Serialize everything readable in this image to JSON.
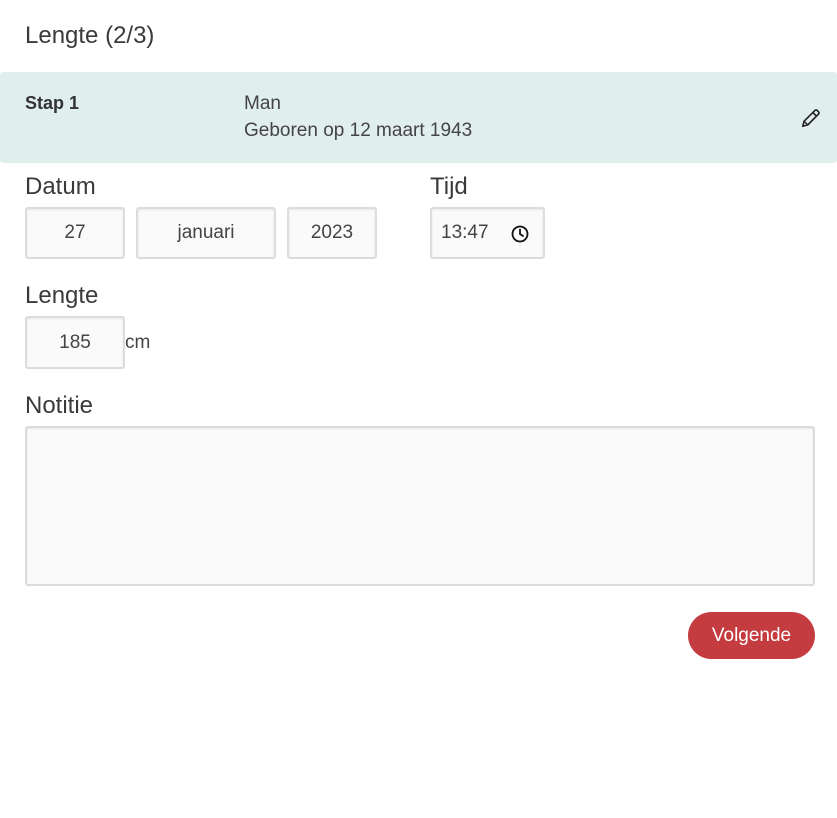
{
  "page": {
    "title": "Lengte (2/3)"
  },
  "step": {
    "label": "Stap 1",
    "gender": "Man",
    "birth": "Geboren op 12 maart 1943",
    "edit_icon": "pencil-icon"
  },
  "datum": {
    "label": "Datum",
    "day": "27",
    "month": "januari",
    "year": "2023"
  },
  "tijd": {
    "label": "Tijd",
    "value": "13:47",
    "icon": "clock-icon"
  },
  "lengte": {
    "label": "Lengte",
    "value": "185",
    "unit": "cm"
  },
  "notitie": {
    "label": "Notitie",
    "value": ""
  },
  "actions": {
    "next_label": "Volgende",
    "next_color": "#c43b40"
  },
  "colors": {
    "summary_bg": "#e1eeee"
  }
}
